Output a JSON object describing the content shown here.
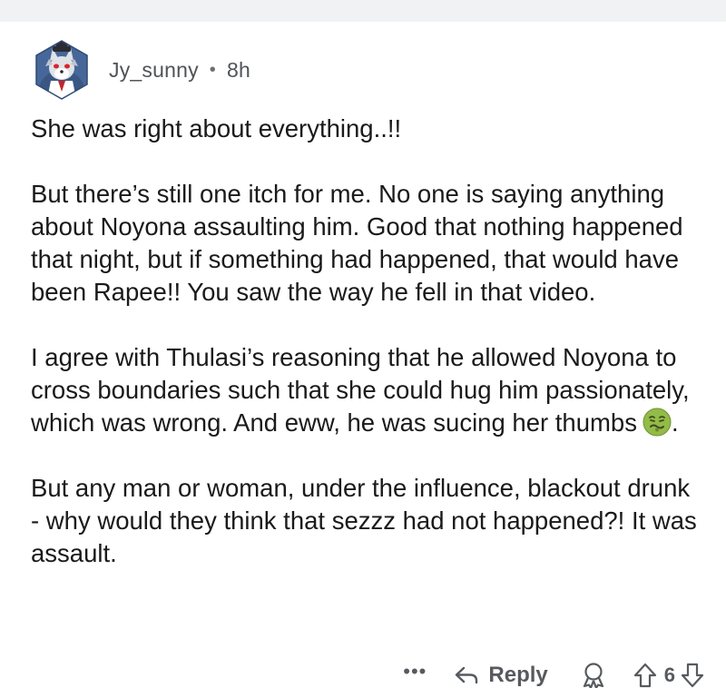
{
  "comment": {
    "username": "Jy_sunny",
    "separator": "•",
    "timestamp": "8h",
    "paragraphs": [
      "She was right about everything..!!",
      "But there’s still one itch for me. No one is saying anything about Noyona assaulting him. Good that nothing happened that night, but if something had happened, that would have been Rapee!! You saw the way he fell in that video.",
      "I agree with Thulasi’s reasoning that he allowed Noyona to cross boundaries such that she could hug him passionately, which was wrong. And eww, he was sucing her thumbs",
      "But any man or woman, under the influence, blackout drunk - why would they think that sezzz had not happened?! It was assault."
    ],
    "paragraph3_suffix": ".",
    "emoji": "nauseated-face-icon"
  },
  "actions": {
    "more_label": "•••",
    "reply_label": "Reply",
    "vote_count": "6"
  },
  "colors": {
    "text": "#1a1a1b",
    "meta": "#505357",
    "top_strip": "#f1f2f3",
    "avatar_bg": "#3f5f8a",
    "emoji_fill": "#8fb84a"
  }
}
